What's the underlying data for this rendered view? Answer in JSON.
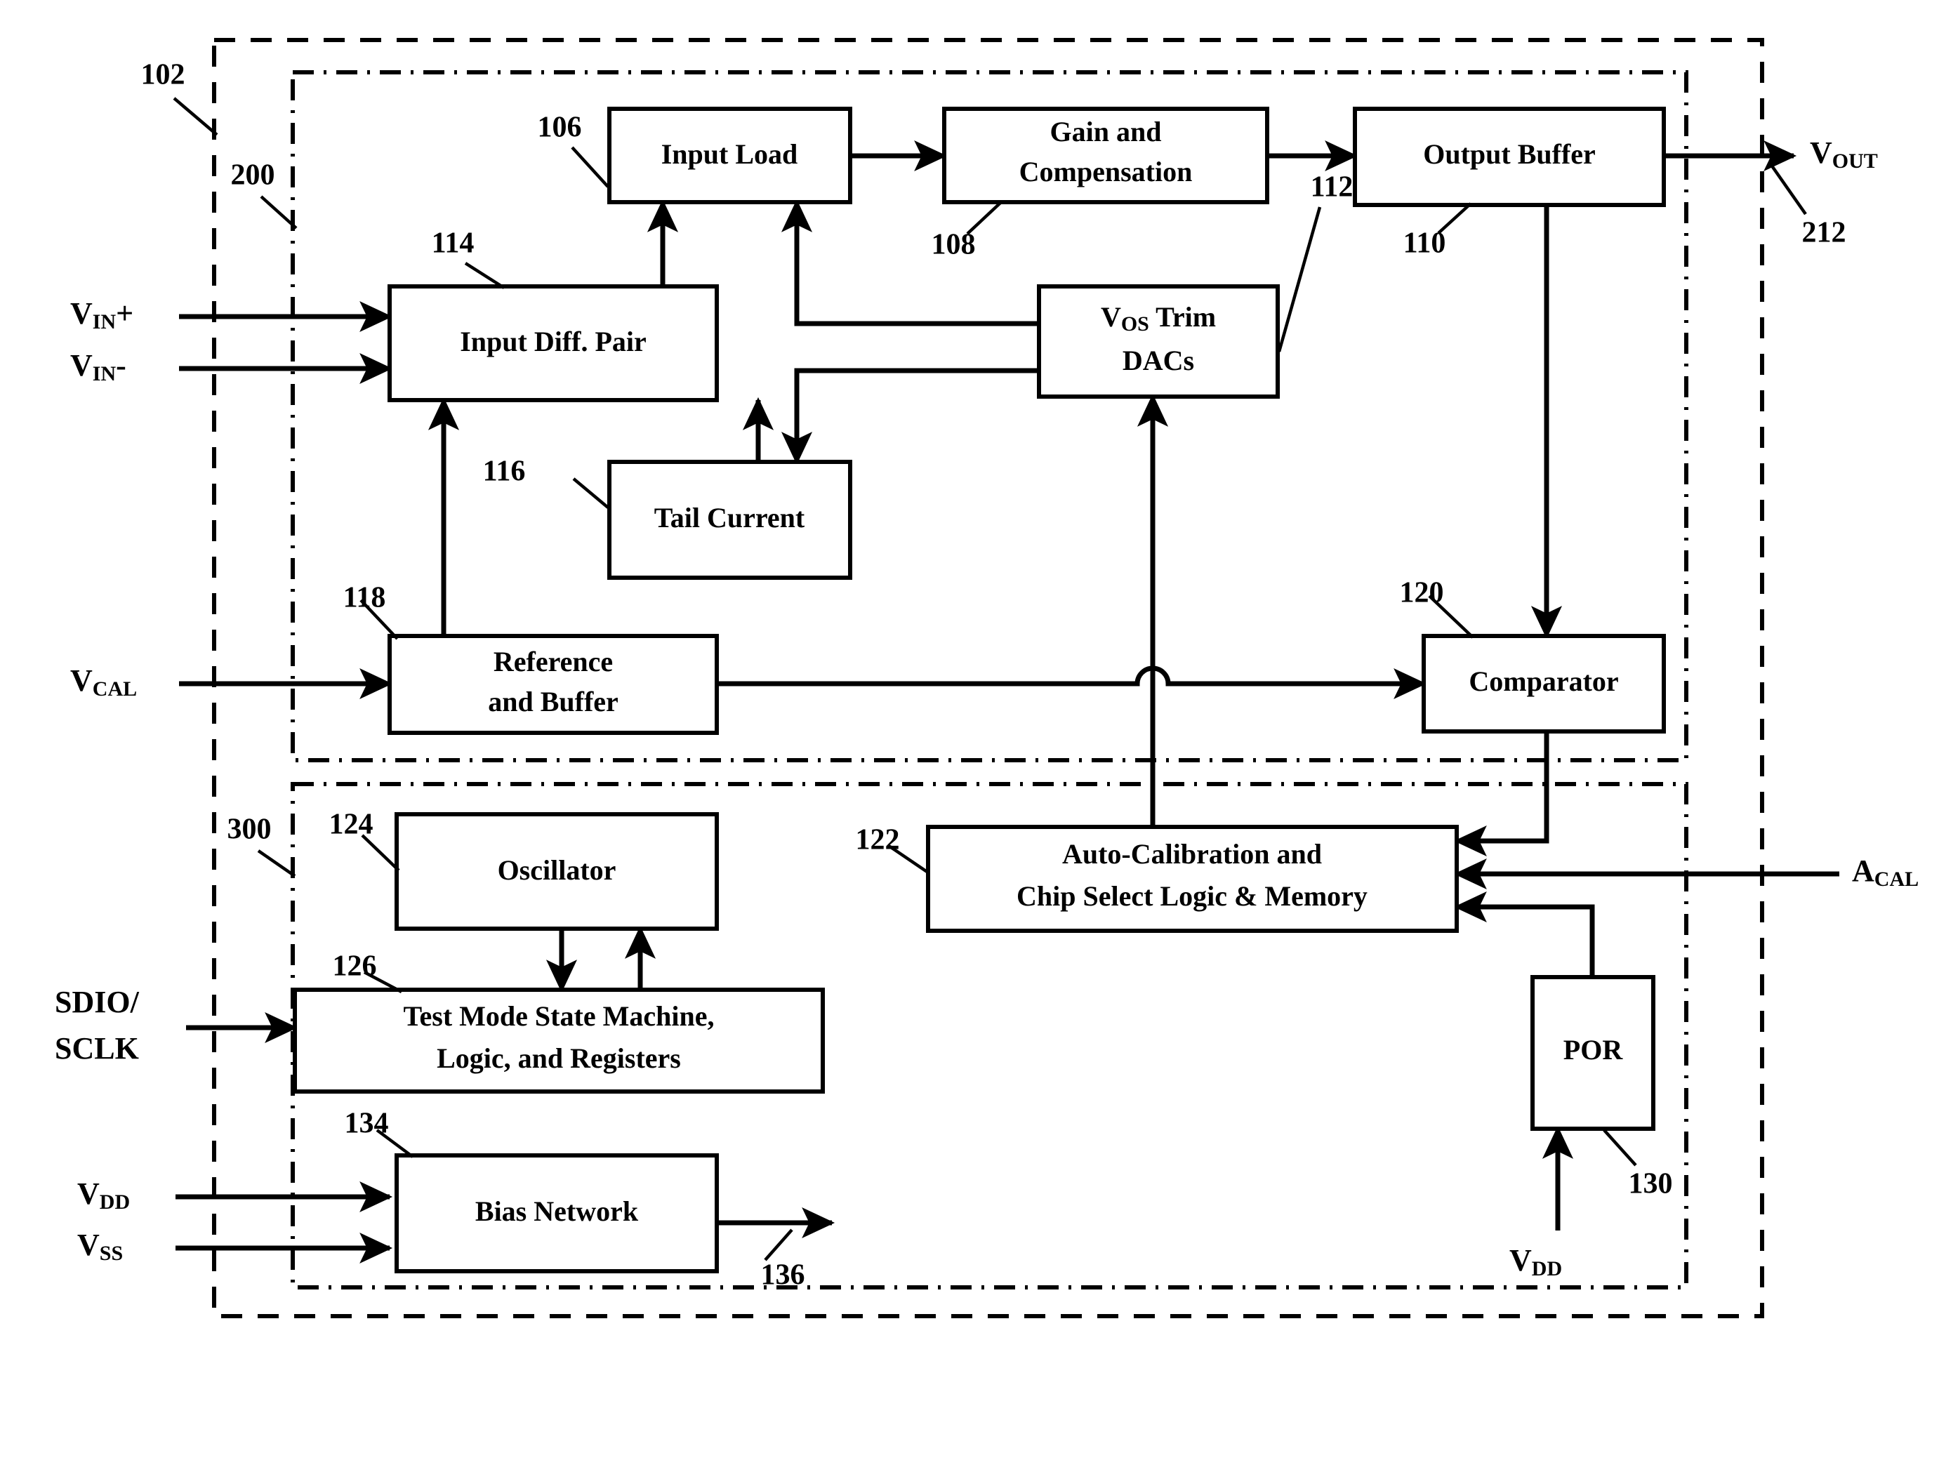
{
  "figure": {
    "type": "patent-block-diagram",
    "title": "Auto-calibrating amplifier block diagram"
  },
  "boundaries": [
    {
      "ref": "102",
      "style": "dashed",
      "label": "102"
    },
    {
      "ref": "200",
      "style": "dash-dot",
      "label": "200"
    },
    {
      "ref": "300",
      "style": "dash-dot",
      "label": "300"
    }
  ],
  "blocks": [
    {
      "id": "input_load",
      "label": "Input Load",
      "ref": "106"
    },
    {
      "id": "gain_comp",
      "label_line1": "Gain and",
      "label_line2": "Compensation",
      "ref": "108"
    },
    {
      "id": "output_buffer",
      "label": "Output Buffer",
      "ref": "110"
    },
    {
      "id": "vos_dacs",
      "label_line1": "V",
      "label_line1_sub": "OS",
      "label_line1_rest": " Trim",
      "label_line2": "DACs",
      "ref": "112"
    },
    {
      "id": "input_diff",
      "label": "Input Diff. Pair",
      "ref": "114"
    },
    {
      "id": "tail_current",
      "label": "Tail Current",
      "ref": "116"
    },
    {
      "id": "ref_buffer",
      "label_line1": "Reference",
      "label_line2": "and Buffer",
      "ref": "118"
    },
    {
      "id": "comparator",
      "label": "Comparator",
      "ref": "120"
    },
    {
      "id": "autocal",
      "label_line1": "Auto-Calibration and",
      "label_line2": "Chip Select Logic & Memory",
      "ref": "122"
    },
    {
      "id": "oscillator",
      "label": "Oscillator",
      "ref": "124"
    },
    {
      "id": "test_mode",
      "label_line1": "Test Mode State Machine,",
      "label_line2": "Logic, and Registers",
      "ref": "126"
    },
    {
      "id": "por",
      "label": "POR",
      "ref": "130"
    },
    {
      "id": "bias_network",
      "label": "Bias Network",
      "ref": "134"
    }
  ],
  "signals": [
    {
      "id": "vin_plus",
      "base": "V",
      "sub": "IN",
      "suffix": "+"
    },
    {
      "id": "vin_minus",
      "base": "V",
      "sub": "IN",
      "suffix": "-"
    },
    {
      "id": "vcal",
      "base": "V",
      "sub": "CAL",
      "suffix": ""
    },
    {
      "id": "vout",
      "base": "V",
      "sub": "OUT",
      "suffix": "",
      "ref": "212"
    },
    {
      "id": "acal",
      "base": "A",
      "sub": "CAL",
      "suffix": ""
    },
    {
      "id": "sdio_sclk",
      "line1": "SDIO/",
      "line2": "SCLK"
    },
    {
      "id": "vdd_bias",
      "base": "V",
      "sub": "DD",
      "suffix": ""
    },
    {
      "id": "vss_bias",
      "base": "V",
      "sub": "SS",
      "suffix": ""
    },
    {
      "id": "vdd_por",
      "base": "V",
      "sub": "DD",
      "suffix": ""
    },
    {
      "id": "bias_out",
      "ref": "136"
    }
  ],
  "reference_numerals": [
    "102",
    "106",
    "108",
    "110",
    "112",
    "114",
    "116",
    "118",
    "120",
    "122",
    "124",
    "126",
    "130",
    "134",
    "136",
    "200",
    "212",
    "300"
  ]
}
